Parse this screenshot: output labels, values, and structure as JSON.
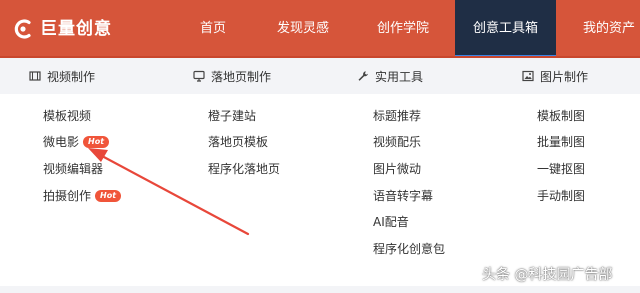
{
  "brand": {
    "name": "巨量创意"
  },
  "nav": {
    "items": [
      "首页",
      "发现灵感",
      "创作学院",
      "创意工具箱",
      "我的资产"
    ],
    "active": "创意工具箱"
  },
  "categories": [
    {
      "label": "视频制作",
      "icon": "film-icon"
    },
    {
      "label": "落地页制作",
      "icon": "monitor-icon"
    },
    {
      "label": "实用工具",
      "icon": "wrench-icon"
    },
    {
      "label": "图片制作",
      "icon": "image-icon"
    }
  ],
  "columns": [
    [
      {
        "label": "模板视频"
      },
      {
        "label": "微电影",
        "badge": "Hot"
      },
      {
        "label": "视频编辑器"
      },
      {
        "label": "拍摄创作",
        "badge": "Hot"
      }
    ],
    [
      {
        "label": "橙子建站"
      },
      {
        "label": "落地页模板"
      },
      {
        "label": "程序化落地页"
      }
    ],
    [
      {
        "label": "标题推荐"
      },
      {
        "label": "视频配乐"
      },
      {
        "label": "图片微动"
      },
      {
        "label": "语音转字幕"
      },
      {
        "label": "AI配音"
      },
      {
        "label": "程序化创意包"
      }
    ],
    [
      {
        "label": "模板制图"
      },
      {
        "label": "批量制图"
      },
      {
        "label": "一键抠图"
      },
      {
        "label": "手动制图"
      }
    ]
  ],
  "watermark": "头条 @科技园广告部",
  "colors": {
    "header": "#d6553a",
    "active_tab": "#1f2e45",
    "active_underline": "#3b84e6",
    "hot_badge": "#f0553a",
    "arrow": "#e8473a"
  }
}
